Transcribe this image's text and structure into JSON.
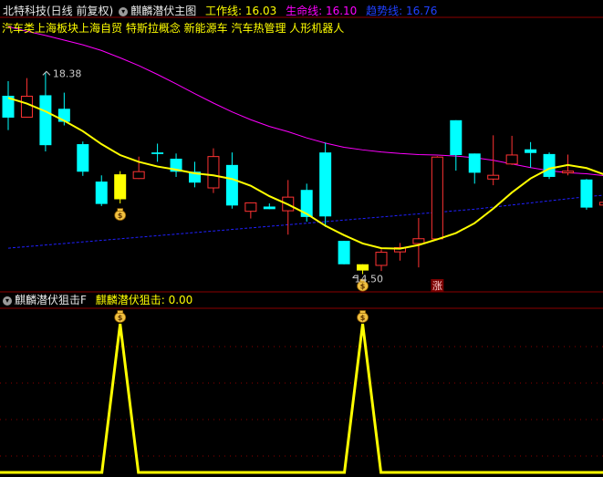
{
  "header": {
    "stock_label": "北特科技(日线 前复权)",
    "indicator_name": "麒麟潜伏主图",
    "work_line_label": "工作线: ",
    "work_line_value": "16.03",
    "life_line_label": "生命线: ",
    "life_line_value": "16.10",
    "trend_line_label": "趋势线: ",
    "trend_line_value": "16.76",
    "concepts": "汽车类上海板块上海自贸 特斯拉概念 新能源车 汽车热管理 人形机器人"
  },
  "sub_header": {
    "indicator_name": "麒麟潜伏狙击F",
    "value_label": "麒麟潜伏狙击: ",
    "value": "0.00"
  },
  "colors": {
    "up": "#ff3333",
    "down": "#00ffff",
    "signal": "#ffff00",
    "work_line": "#ffff00",
    "life_line": "#ff00ff",
    "trend_line": "#2020ff",
    "grid": "#8b0000",
    "background": "#000000"
  },
  "icons": {
    "signal_marker": "money-bag-icon",
    "limit_up_badge": "zhang-badge"
  },
  "annotations": {
    "high_label": "18.38",
    "low_label": "14.50",
    "limit_up": "涨"
  },
  "chart_data": [
    {
      "type": "candlestick",
      "price_range": [
        14.3,
        19.0
      ],
      "series": [
        {
          "name": "K",
          "candles": [
            {
              "o": 17.93,
              "h": 18.21,
              "l": 17.27,
              "c": 17.51
            },
            {
              "o": 17.51,
              "h": 18.27,
              "l": 17.51,
              "c": 17.93
            },
            {
              "o": 17.94,
              "h": 18.38,
              "l": 16.86,
              "c": 16.98
            },
            {
              "o": 17.68,
              "h": 17.99,
              "l": 17.36,
              "c": 17.43
            },
            {
              "o": 17.0,
              "h": 17.05,
              "l": 16.39,
              "c": 16.47
            },
            {
              "o": 16.28,
              "h": 16.4,
              "l": 15.81,
              "c": 15.85
            },
            {
              "o": 15.94,
              "h": 16.48,
              "l": 15.86,
              "c": 16.42
            },
            {
              "o": 16.33,
              "h": 16.76,
              "l": 16.33,
              "c": 16.48
            },
            {
              "o": 16.84,
              "h": 17.01,
              "l": 16.66,
              "c": 16.81
            },
            {
              "o": 16.72,
              "h": 16.82,
              "l": 16.37,
              "c": 16.47
            },
            {
              "o": 16.47,
              "h": 16.66,
              "l": 16.17,
              "c": 16.26
            },
            {
              "o": 16.15,
              "h": 16.92,
              "l": 16.06,
              "c": 16.77
            },
            {
              "o": 16.6,
              "h": 16.84,
              "l": 15.76,
              "c": 15.82
            },
            {
              "o": 15.7,
              "h": 15.88,
              "l": 15.57,
              "c": 15.88
            },
            {
              "o": 15.8,
              "h": 15.86,
              "l": 15.75,
              "c": 15.75
            },
            {
              "o": 15.71,
              "h": 16.31,
              "l": 15.26,
              "c": 15.99
            },
            {
              "o": 16.12,
              "h": 16.24,
              "l": 15.51,
              "c": 15.6
            },
            {
              "o": 16.84,
              "h": 17.03,
              "l": 15.41,
              "c": 15.61
            },
            {
              "o": 15.14,
              "h": 15.14,
              "l": 14.69,
              "c": 14.69
            },
            {
              "o": 14.69,
              "h": 14.69,
              "l": 14.5,
              "c": 14.57
            },
            {
              "o": 14.66,
              "h": 14.98,
              "l": 14.56,
              "c": 14.93
            },
            {
              "o": 14.92,
              "h": 15.1,
              "l": 14.76,
              "c": 15.02
            },
            {
              "o": 15.08,
              "h": 15.58,
              "l": 14.63,
              "c": 15.19
            },
            {
              "o": 15.17,
              "h": 16.77,
              "l": 15.17,
              "c": 16.76
            },
            {
              "o": 17.46,
              "h": 17.46,
              "l": 16.49,
              "c": 16.79
            },
            {
              "o": 16.82,
              "h": 16.82,
              "l": 16.24,
              "c": 16.45
            },
            {
              "o": 16.32,
              "h": 17.17,
              "l": 16.21,
              "c": 16.41
            },
            {
              "o": 16.61,
              "h": 17.16,
              "l": 16.6,
              "c": 16.8
            },
            {
              "o": 16.9,
              "h": 17.04,
              "l": 16.55,
              "c": 16.83
            },
            {
              "o": 16.81,
              "h": 16.84,
              "l": 16.33,
              "c": 16.37
            },
            {
              "o": 16.44,
              "h": 16.8,
              "l": 16.4,
              "c": 16.49
            },
            {
              "o": 16.32,
              "h": 16.33,
              "l": 15.74,
              "c": 15.78
            },
            {
              "o": 15.82,
              "h": 16.04,
              "l": 15.8,
              "c": 15.89
            },
            {
              "o": 15.98,
              "h": 16.04,
              "l": 15.79,
              "c": 15.88
            }
          ]
        },
        {
          "name": "工作线",
          "values": [
            17.89,
            17.78,
            17.63,
            17.45,
            17.25,
            17.0,
            16.79,
            16.66,
            16.57,
            16.51,
            16.44,
            16.4,
            16.33,
            16.2,
            16.0,
            15.84,
            15.66,
            15.43,
            15.25,
            15.09,
            15.0,
            14.99,
            15.06,
            15.17,
            15.29,
            15.48,
            15.76,
            16.07,
            16.34,
            16.53,
            16.6,
            16.54,
            16.41,
            16.31
          ]
        },
        {
          "name": "生命线",
          "values": [
            19.26,
            19.17,
            19.09,
            19.0,
            18.91,
            18.8,
            18.66,
            18.51,
            18.34,
            18.16,
            17.97,
            17.79,
            17.62,
            17.47,
            17.34,
            17.24,
            17.12,
            17.02,
            16.94,
            16.89,
            16.85,
            16.82,
            16.8,
            16.79,
            16.77,
            16.74,
            16.69,
            16.62,
            16.55,
            16.49,
            16.45,
            16.43,
            16.39,
            16.36
          ]
        },
        {
          "name": "趋势线",
          "values": [
            15.0,
            15.03,
            15.06,
            15.09,
            15.12,
            15.15,
            15.18,
            15.21,
            15.24,
            15.27,
            15.3,
            15.33,
            15.36,
            15.39,
            15.42,
            15.45,
            15.48,
            15.51,
            15.54,
            15.57,
            15.6,
            15.63,
            15.66,
            15.69,
            15.72,
            15.75,
            15.79,
            15.83,
            15.87,
            15.91,
            15.95,
            15.99,
            16.02,
            16.05
          ]
        },
        {
          "name": "signals",
          "candle_indices": [
            6,
            19
          ]
        }
      ]
    },
    {
      "type": "line",
      "name": "麒麟潜伏狙击",
      "ylim": [
        0,
        1
      ],
      "values": [
        0,
        0,
        0,
        0,
        0,
        0,
        1,
        0,
        0,
        0,
        0,
        0,
        0,
        0,
        0,
        0,
        0,
        0,
        0,
        1,
        0,
        0,
        0,
        0,
        0,
        0,
        0,
        0,
        0,
        0,
        0,
        0,
        0,
        0
      ]
    }
  ]
}
